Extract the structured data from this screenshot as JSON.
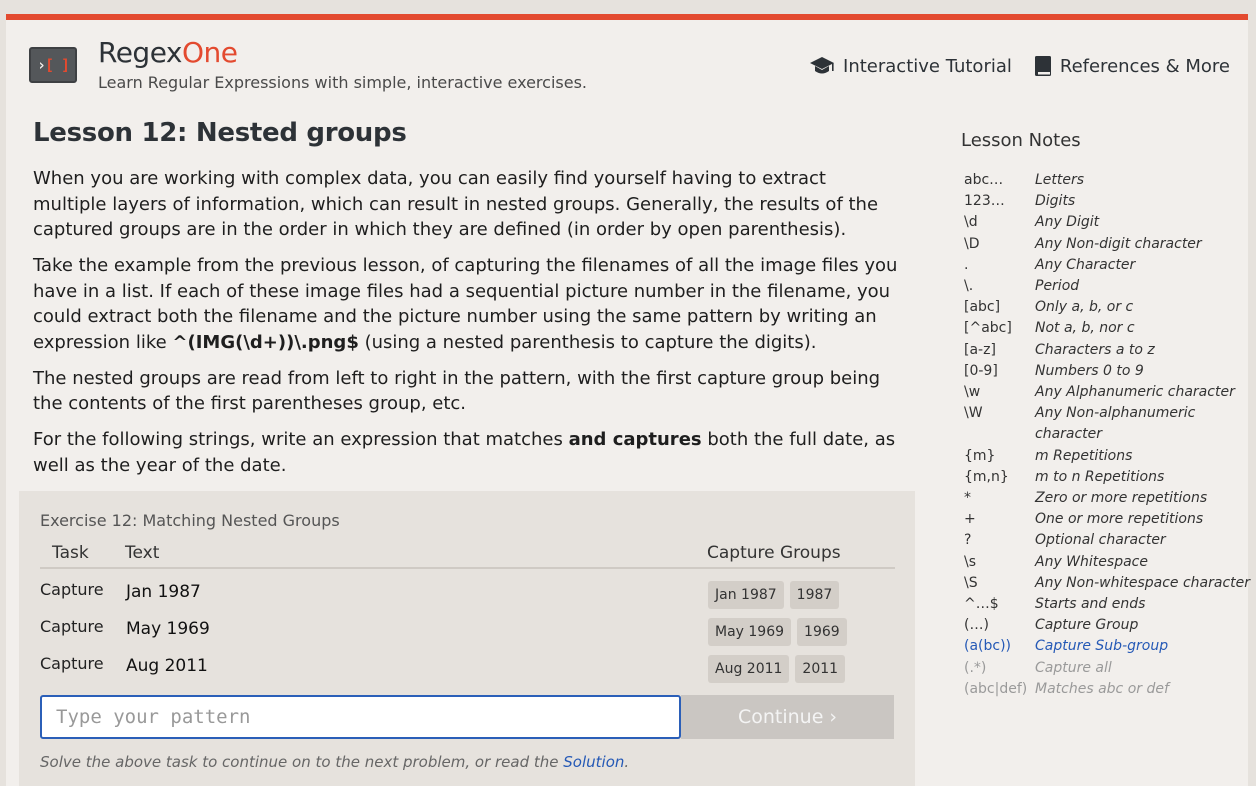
{
  "header": {
    "brand_main": "Regex",
    "brand_accent": "One",
    "tagline": "Learn Regular Expressions with simple, interactive exercises.",
    "nav": [
      {
        "label": "Interactive Tutorial",
        "icon": "graduation-cap-icon"
      },
      {
        "label": "References & More",
        "icon": "book-icon"
      }
    ]
  },
  "lesson": {
    "title": "Lesson 12: Nested groups",
    "p1": "When you are working with complex data, you can easily find yourself having to extract multiple layers of information, which can result in nested groups. Generally, the results of the captured groups are in the order in which they are defined (in order by open parenthesis).",
    "p2_before": "Take the example from the previous lesson, of capturing the filenames of all the image files you have in a list. If each of these image files had a sequential picture number in the filename, you could extract both the filename and the picture number using the same pattern by writing an expression like ",
    "p2_code": "^(IMG(\\d+))\\.png$",
    "p2_after": " (using a nested parenthesis to capture the digits).",
    "p3": "The nested groups are read from left to right in the pattern, with the first capture group being the contents of the first parentheses group, etc.",
    "p4_before": "For the following strings, write an expression that matches ",
    "p4_bold": "and captures",
    "p4_after": " both the full date, as well as the year of the date."
  },
  "exercise": {
    "title": "Exercise 12: Matching Nested Groups",
    "headers": {
      "task": "Task",
      "text": "Text",
      "capture": "Capture Groups"
    },
    "rows": [
      {
        "task": "Capture",
        "text": "Jan 1987",
        "groups": [
          "Jan 1987",
          "1987"
        ]
      },
      {
        "task": "Capture",
        "text": "May 1969",
        "groups": [
          "May 1969",
          "1969"
        ]
      },
      {
        "task": "Capture",
        "text": "Aug 2011",
        "groups": [
          "Aug 2011",
          "2011"
        ]
      }
    ],
    "input_placeholder": "Type your pattern",
    "input_value": "",
    "continue_label": "Continue ›",
    "note_before": "Solve the above task to continue on to the next problem, or read the ",
    "note_link": "Solution",
    "note_after": "."
  },
  "notes": {
    "title": "Lesson Notes",
    "items": [
      {
        "k": "abc…",
        "v": "Letters"
      },
      {
        "k": "123…",
        "v": "Digits"
      },
      {
        "k": "\\d",
        "v": "Any Digit"
      },
      {
        "k": "\\D",
        "v": "Any Non-digit character"
      },
      {
        "k": ".",
        "v": "Any Character"
      },
      {
        "k": "\\.",
        "v": "Period"
      },
      {
        "k": "[abc]",
        "v": "Only a, b, or c"
      },
      {
        "k": "[^abc]",
        "v": "Not a, b, nor c"
      },
      {
        "k": "[a-z]",
        "v": "Characters a to z"
      },
      {
        "k": "[0-9]",
        "v": "Numbers 0 to 9"
      },
      {
        "k": "\\w",
        "v": "Any Alphanumeric character"
      },
      {
        "k": "\\W",
        "v": "Any Non-alphanumeric character"
      },
      {
        "k": "{m}",
        "v": "m Repetitions"
      },
      {
        "k": "{m,n}",
        "v": "m to n Repetitions"
      },
      {
        "k": "*",
        "v": "Zero or more repetitions"
      },
      {
        "k": "+",
        "v": "One or more repetitions"
      },
      {
        "k": "?",
        "v": "Optional character"
      },
      {
        "k": "\\s",
        "v": "Any Whitespace"
      },
      {
        "k": "\\S",
        "v": "Any Non-whitespace character"
      },
      {
        "k": "^…$",
        "v": "Starts and ends"
      },
      {
        "k": "(…)",
        "v": "Capture Group"
      },
      {
        "k": "(a(bc))",
        "v": "Capture Sub-group",
        "state": "active"
      },
      {
        "k": "(.*)",
        "v": "Capture all",
        "state": "dim"
      },
      {
        "k": "(abc|def)",
        "v": "Matches abc or def",
        "state": "dim"
      }
    ]
  },
  "colors": {
    "accent": "#e34a2f",
    "link": "#2559b6",
    "background": "#f2efec"
  }
}
